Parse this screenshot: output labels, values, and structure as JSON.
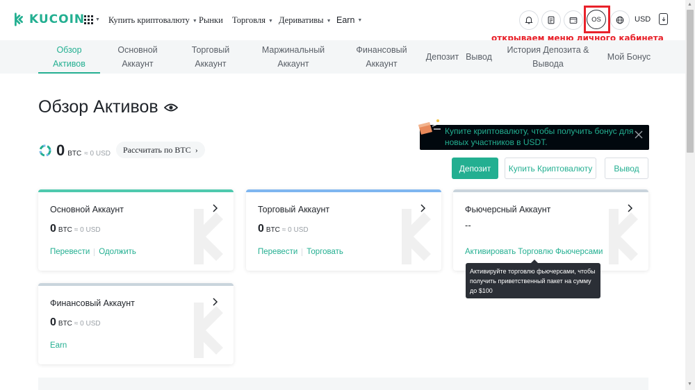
{
  "brand": {
    "name": "KUCOIN",
    "color": "#23af91"
  },
  "nav": {
    "grid_icon": "apps-grid-icon",
    "items": [
      {
        "label": "Купить криптовалюту",
        "has_caret": true
      },
      {
        "label": "Рынки",
        "has_caret": false
      },
      {
        "label": "Торговля",
        "has_caret": true
      },
      {
        "label": "Деривативы",
        "has_caret": true
      },
      {
        "label": "Earn",
        "has_caret": true
      }
    ],
    "icons": [
      "bell-icon",
      "orders-icon",
      "wallet-icon",
      "globe-icon",
      "download-icon"
    ],
    "avatar_initials": "OS",
    "currency": "USD"
  },
  "annotation": {
    "text": "открываем меню личного кабинета",
    "color": "#e8212a"
  },
  "subnav": {
    "tabs": [
      {
        "label": "Обзор Активов",
        "active": true
      },
      {
        "label": "Основной Аккаунт",
        "active": false
      },
      {
        "label": "Торговый Аккаунт",
        "active": false
      },
      {
        "label": "Маржинальный Аккаунт",
        "active": false
      },
      {
        "label": "Финансовый Аккаунт",
        "active": false
      },
      {
        "label": "Депозит",
        "active": false
      },
      {
        "label": "Вывод",
        "active": false
      },
      {
        "label": "История Депозита & Вывода",
        "active": false
      },
      {
        "label": "Мой Бонус",
        "active": false
      }
    ]
  },
  "page": {
    "title": "Обзор Активов",
    "total": {
      "value": "0",
      "unit": "BTC",
      "usd": "≈ 0 USD"
    },
    "calc_button": "Рассчитать по BTC",
    "promo": "Купите криптовалюту, чтобы получить бонус для новых участников в USDT.",
    "buttons": {
      "deposit": "Депозит",
      "buy": "Купить Криптовалюту",
      "withdraw": "Вывод"
    }
  },
  "cards": [
    {
      "title": "Основной Аккаунт",
      "value": "0",
      "unit": "BTC",
      "usd": "≈ 0 USD",
      "links": [
        "Перевести",
        "Одолжить"
      ],
      "top_color": "#4ec9ae"
    },
    {
      "title": "Торговый Аккаунт",
      "value": "0",
      "unit": "BTC",
      "usd": "≈ 0 USD",
      "links": [
        "Перевести",
        "Торговать"
      ],
      "top_color": "#7fb6f0"
    },
    {
      "title": "Фьючерсный Аккаунт",
      "dash": "--",
      "links": [
        "Активировать Торговлю Фьючерсами"
      ],
      "top_color": "#c9d4dc"
    },
    {
      "title": "Финансовый Аккаунт",
      "value": "0",
      "unit": "BTC",
      "usd": "≈ 0 USD",
      "links": [
        "Earn"
      ],
      "top_color": "#c9d4dc"
    }
  ],
  "tooltip": "Активируйте торговлю фьючерсами, чтобы получить приветственный пакет на сумму до $100"
}
